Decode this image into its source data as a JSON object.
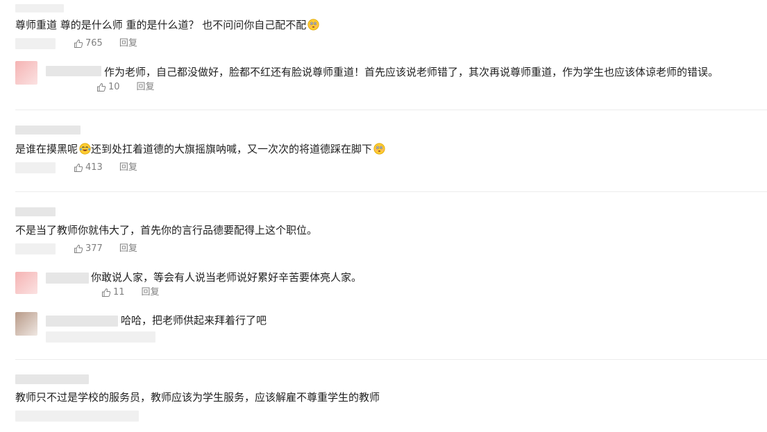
{
  "comments": [
    {
      "text": "尊师重道 尊的是什么师 重的是什么道？ 也不问问你自己配不配",
      "likes": "765",
      "reply_label": "回复",
      "emoji": "flushed-face-icon",
      "replies": [
        {
          "text": "作为老师，自己都没做好，脸都不红还有脸说尊师重道！首先应该说老师错了，其次再说尊师重道，作为学生也应该体谅老师的错误。",
          "likes": "10",
          "reply_label": "回复"
        }
      ]
    },
    {
      "text_before": "是谁在摸黑呢",
      "text_after": "还到处扛着道德的大旗摇旗呐喊，又一次次的将道德踩在脚下",
      "emoji_1": "tears-of-joy-icon",
      "emoji_2": "flushed-face-icon",
      "likes": "413",
      "reply_label": "回复"
    },
    {
      "text": "不是当了教师你就伟大了，首先你的言行品德要配得上这个职位。",
      "likes": "377",
      "reply_label": "回复",
      "replies": [
        {
          "text": "你敢说人家，等会有人说当老师说好累好辛苦要体亮人家。",
          "likes": "11",
          "reply_label": "回复"
        },
        {
          "text": "哈哈，把老师供起来拜着行了吧"
        }
      ]
    },
    {
      "text": "教师只不过是学校的服务员，教师应该为学生服务，应该解雇不尊重学生的教师"
    }
  ],
  "colors": {
    "text": "#1f1f1f",
    "meta": "#808080",
    "divider": "#ececec"
  }
}
